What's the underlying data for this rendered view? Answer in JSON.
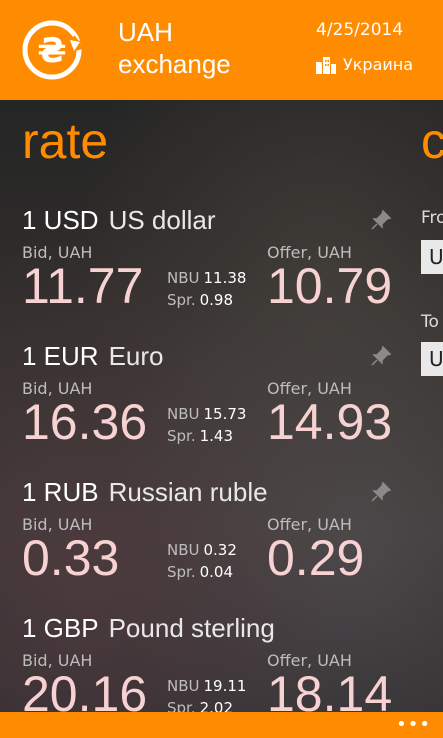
{
  "header": {
    "title": "UAH exchange",
    "date": "4/25/2014",
    "region": "Украина"
  },
  "pivot": {
    "title": "rate",
    "next_title_partial": "c"
  },
  "side_panel": {
    "from_label": "Fro",
    "from_value": "U",
    "to_label": "To",
    "to_value": "U"
  },
  "labels": {
    "bid": "Bid, UAH",
    "offer": "Offer, UAH",
    "nbu": "NBU",
    "spread": "Spr."
  },
  "currencies": [
    {
      "amount_code": "1 USD",
      "name": "US dollar",
      "bid": "11.77",
      "nbu": "11.38",
      "spread": "0.98",
      "offer": "10.79"
    },
    {
      "amount_code": "1 EUR",
      "name": "Euro",
      "bid": "16.36",
      "nbu": "15.73",
      "spread": "1.43",
      "offer": "14.93"
    },
    {
      "amount_code": "1 RUB",
      "name": "Russian ruble",
      "bid": "0.33",
      "nbu": "0.32",
      "spread": "0.04",
      "offer": "0.29"
    },
    {
      "amount_code": "1 GBP",
      "name": "Pound sterling",
      "bid": "20.16",
      "nbu": "19.11",
      "spread": "2.02",
      "offer": "18.14"
    }
  ],
  "appbar": {
    "more_label": "•••"
  },
  "colors": {
    "accent": "#FF8C00",
    "value": "#F7D2D2"
  },
  "icons": {
    "logo": "hryvnia-exchange-icon",
    "region": "buildings-icon",
    "pin": "pin-icon"
  }
}
